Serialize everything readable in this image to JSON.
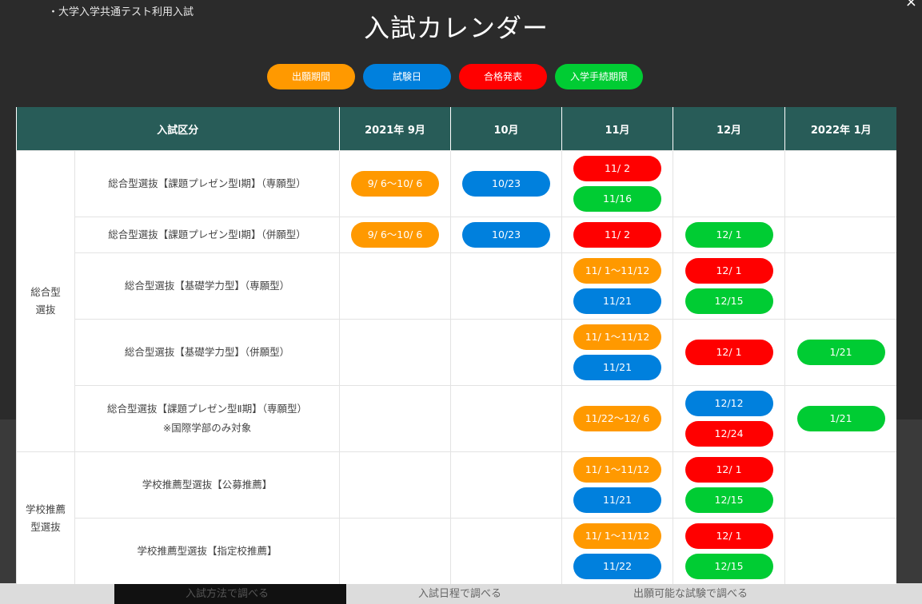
{
  "breadcrumb": "・大学入学共通テスト利用入試",
  "title": "入試カレンダー",
  "close_label": "×",
  "colors": {
    "orange": "#ff9900",
    "blue": "#0080dd",
    "red": "#ff0000",
    "green": "#00cc33",
    "header_bg": "#285c58"
  },
  "legend": [
    {
      "label": "出願期間",
      "color": "orange"
    },
    {
      "label": "試験日",
      "color": "blue"
    },
    {
      "label": "合格発表",
      "color": "red"
    },
    {
      "label": "入学手続期限",
      "color": "green"
    }
  ],
  "table": {
    "headers": [
      "入試区分",
      "2021年 9月",
      "10月",
      "11月",
      "12月",
      "2022年 1月"
    ],
    "groups": [
      {
        "category": [
          "総合型",
          "選抜"
        ],
        "rows": [
          {
            "name": [
              "総合型選抜【課題プレゼン型Ⅰ期】（専願型）"
            ],
            "cells": [
              [
                {
                  "t": "9/ 6〜10/ 6",
                  "c": "orange"
                }
              ],
              [
                {
                  "t": "10/23",
                  "c": "blue"
                }
              ],
              [
                {
                  "t": "11/ 2",
                  "c": "red"
                },
                {
                  "t": "11/16",
                  "c": "green"
                }
              ],
              [],
              []
            ]
          },
          {
            "name": [
              "総合型選抜【課題プレゼン型Ⅰ期】（併願型）"
            ],
            "cells": [
              [
                {
                  "t": "9/ 6〜10/ 6",
                  "c": "orange"
                }
              ],
              [
                {
                  "t": "10/23",
                  "c": "blue"
                }
              ],
              [
                {
                  "t": "11/ 2",
                  "c": "red"
                }
              ],
              [
                {
                  "t": "12/ 1",
                  "c": "green"
                }
              ],
              []
            ]
          },
          {
            "name": [
              "総合型選抜【基礎学力型】（専願型）"
            ],
            "cells": [
              [],
              [],
              [
                {
                  "t": "11/ 1〜11/12",
                  "c": "orange"
                },
                {
                  "t": "11/21",
                  "c": "blue"
                }
              ],
              [
                {
                  "t": "12/ 1",
                  "c": "red"
                },
                {
                  "t": "12/15",
                  "c": "green"
                }
              ],
              []
            ]
          },
          {
            "name": [
              "総合型選抜【基礎学力型】（併願型）"
            ],
            "cells": [
              [],
              [],
              [
                {
                  "t": "11/ 1〜11/12",
                  "c": "orange"
                },
                {
                  "t": "11/21",
                  "c": "blue"
                }
              ],
              [
                {
                  "t": "12/ 1",
                  "c": "red"
                }
              ],
              [
                {
                  "t": "1/21",
                  "c": "green"
                }
              ]
            ]
          },
          {
            "name": [
              "総合型選抜【課題プレゼン型Ⅱ期】（専願型）",
              "※国際学部のみ対象"
            ],
            "cells": [
              [],
              [],
              [
                {
                  "t": "11/22〜12/ 6",
                  "c": "orange"
                }
              ],
              [
                {
                  "t": "12/12",
                  "c": "blue"
                },
                {
                  "t": "12/24",
                  "c": "red"
                }
              ],
              [
                {
                  "t": "1/21",
                  "c": "green"
                }
              ]
            ]
          }
        ]
      },
      {
        "category": [
          "学校推薦",
          "型選抜"
        ],
        "rows": [
          {
            "name": [
              "学校推薦型選抜【公募推薦】"
            ],
            "cells": [
              [],
              [],
              [
                {
                  "t": "11/ 1〜11/12",
                  "c": "orange"
                },
                {
                  "t": "11/21",
                  "c": "blue"
                }
              ],
              [
                {
                  "t": "12/ 1",
                  "c": "red"
                },
                {
                  "t": "12/15",
                  "c": "green"
                }
              ],
              []
            ]
          },
          {
            "name": [
              "学校推薦型選抜【指定校推薦】"
            ],
            "cells": [
              [],
              [],
              [
                {
                  "t": "11/ 1〜11/12",
                  "c": "orange"
                },
                {
                  "t": "11/22",
                  "c": "blue"
                }
              ],
              [
                {
                  "t": "12/ 1",
                  "c": "red"
                },
                {
                  "t": "12/15",
                  "c": "green"
                }
              ],
              []
            ]
          }
        ]
      }
    ]
  },
  "footer_buttons": [
    "入試方法で調べる",
    "入試日程で調べる",
    "出願可能な試験で調べる"
  ]
}
